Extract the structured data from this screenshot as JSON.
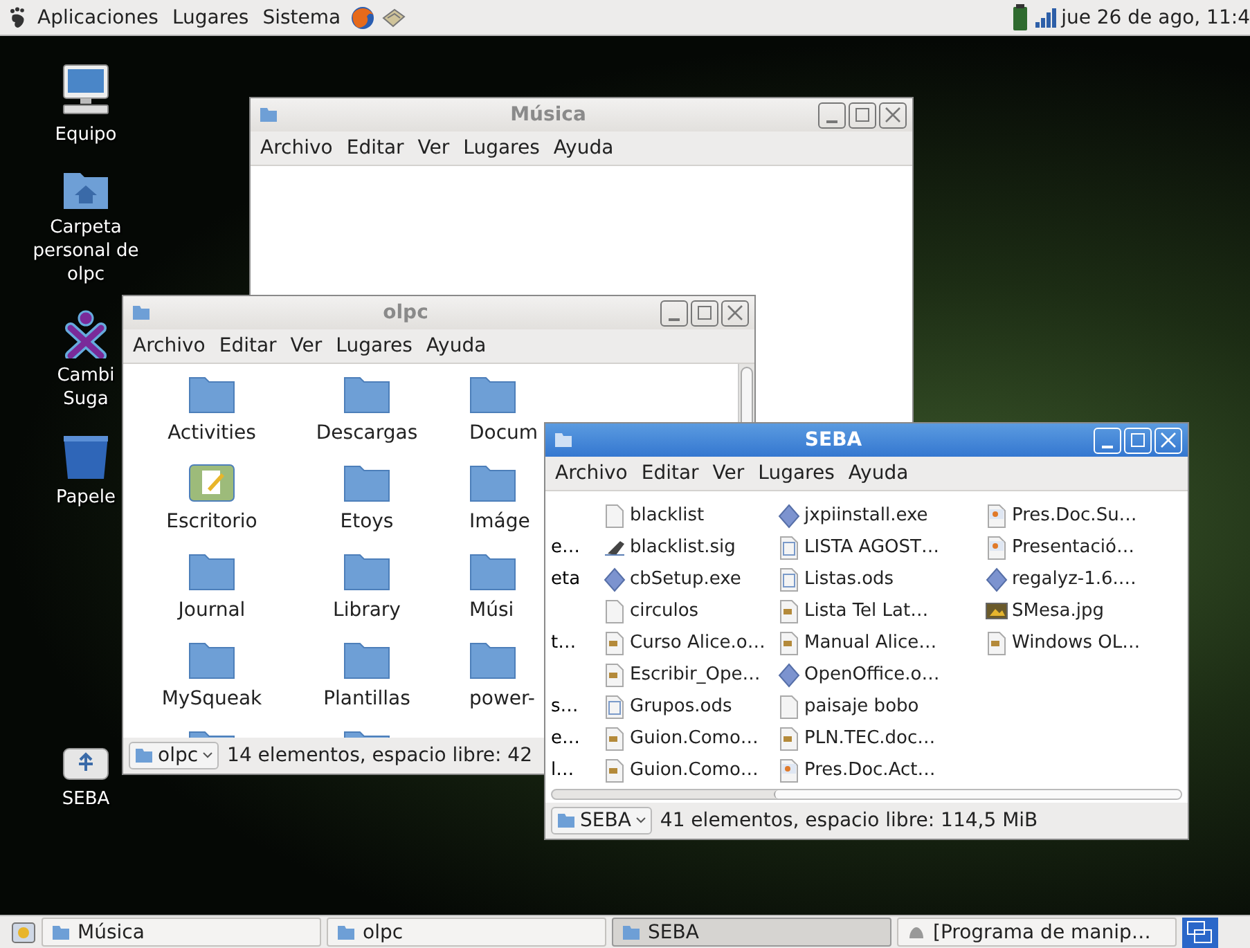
{
  "top_panel": {
    "menus": [
      "Aplicaciones",
      "Lugares",
      "Sistema"
    ],
    "clock": "jue 26 de ago, 11:4"
  },
  "desktop_icons": [
    {
      "kind": "computer",
      "label": "Equipo"
    },
    {
      "kind": "home",
      "label": "Carpeta personal de olpc"
    },
    {
      "kind": "xo",
      "label": "Cambi Suga"
    },
    {
      "kind": "trash",
      "label": "Papele"
    },
    {
      "kind": "drive",
      "label": "SEBA"
    }
  ],
  "windows": [
    {
      "kind": "empty",
      "title": "Música",
      "active": false,
      "menus": [
        "Archivo",
        "Editar",
        "Ver",
        "Lugares",
        "Ayuda"
      ]
    },
    {
      "kind": "icons",
      "title": "olpc",
      "active": false,
      "menus": [
        "Archivo",
        "Editar",
        "Ver",
        "Lugares",
        "Ayuda"
      ],
      "items": [
        {
          "kind": "folder",
          "label": "Activities"
        },
        {
          "kind": "folder",
          "label": "Descargas"
        },
        {
          "kind": "folder",
          "label": "Docum"
        },
        {
          "kind": "desktop",
          "label": "Escritorio"
        },
        {
          "kind": "folder",
          "label": "Etoys"
        },
        {
          "kind": "folder",
          "label": "Imáge"
        },
        {
          "kind": "folder",
          "label": "Journal"
        },
        {
          "kind": "folder",
          "label": "Library"
        },
        {
          "kind": "folder",
          "label": "Músi"
        },
        {
          "kind": "folder",
          "label": "MySqueak"
        },
        {
          "kind": "folder",
          "label": "Plantillas"
        },
        {
          "kind": "folder",
          "label": "power-"
        },
        {
          "kind": "folder"
        },
        {
          "kind": "folder"
        }
      ],
      "location": "olpc",
      "status": "14 elementos, espacio libre: 42"
    },
    {
      "kind": "list",
      "title": "SEBA",
      "active": true,
      "menus": [
        "Archivo",
        "Editar",
        "Ver",
        "Lugares",
        "Ayuda"
      ],
      "rows": [
        {
          "files": [
            {
              "kind": "blank",
              "name": "blacklist"
            },
            {
              "kind": "exe",
              "name": "jxpiinstall.exe"
            },
            {
              "kind": "slides",
              "name": "Pres.Doc.Su…"
            }
          ]
        },
        {
          "cut": "e…",
          "files": [
            {
              "kind": "signature",
              "name": "blacklist.sig"
            },
            {
              "kind": "sheet",
              "name": "LISTA AGOST…"
            },
            {
              "kind": "slides",
              "name": "Presentació…"
            }
          ]
        },
        {
          "cut": "eta",
          "files": [
            {
              "kind": "exe",
              "name": "cbSetup.exe"
            },
            {
              "kind": "sheet",
              "name": "Listas.ods"
            },
            {
              "kind": "exe",
              "name": "regalyz-1.6.…"
            }
          ]
        },
        {
          "files": [
            {
              "kind": "blank",
              "name": "circulos"
            },
            {
              "kind": "doc",
              "name": "Lista Tel Lat…"
            },
            {
              "kind": "image",
              "name": "SMesa.jpg"
            }
          ]
        },
        {
          "cut": "t…",
          "files": [
            {
              "kind": "doc",
              "name": "Curso Alice.o…"
            },
            {
              "kind": "doc",
              "name": "Manual Alice…"
            },
            {
              "kind": "doc",
              "name": "Windows OL…"
            }
          ]
        },
        {
          "files": [
            {
              "kind": "doc",
              "name": "Escribir_Ope…"
            },
            {
              "kind": "exe",
              "name": "OpenOffice.o…"
            }
          ]
        },
        {
          "cut": "s…",
          "files": [
            {
              "kind": "sheet",
              "name": "Grupos.ods"
            },
            {
              "kind": "blank",
              "name": "paisaje bobo"
            }
          ]
        },
        {
          "cut": "e…",
          "files": [
            {
              "kind": "doc",
              "name": "Guion.Como…"
            },
            {
              "kind": "doc",
              "name": "PLN.TEC.doc…"
            }
          ]
        },
        {
          "cut": "l…",
          "files": [
            {
              "kind": "doc",
              "name": "Guion.Como…"
            },
            {
              "kind": "slides",
              "name": "Pres.Doc.Act…"
            }
          ]
        }
      ],
      "location": "SEBA",
      "status": "41 elementos, espacio libre: 114,5 MiB"
    }
  ],
  "taskbar": [
    {
      "label": "Música",
      "kind": "folder",
      "selected": false
    },
    {
      "label": "olpc",
      "kind": "home",
      "selected": false
    },
    {
      "label": "SEBA",
      "kind": "folder",
      "selected": true
    },
    {
      "label": "[Programa de manip…",
      "kind": "app",
      "selected": false
    }
  ]
}
